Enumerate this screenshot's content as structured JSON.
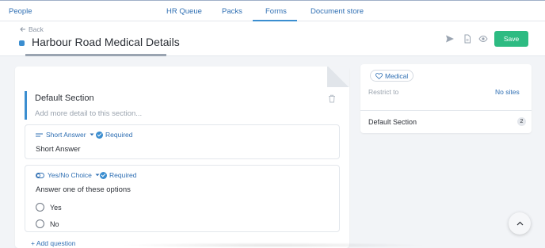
{
  "nav": {
    "people": "People",
    "tabs": [
      {
        "label": "HR Queue"
      },
      {
        "label": "Packs"
      },
      {
        "label": "Forms"
      },
      {
        "label": "Document store"
      }
    ],
    "active_tab": "Forms"
  },
  "header": {
    "back": "Back",
    "title": "Harbour Road Medical Details",
    "save": "Save"
  },
  "form": {
    "section_title": "Default Section",
    "section_placeholder": "Add more detail to this section...",
    "questions": [
      {
        "type": "Short Answer",
        "required": "Required",
        "label": "Short Answer"
      },
      {
        "type": "Yes/No Choice",
        "required": "Required",
        "label": "Answer one of these options",
        "options": [
          "Yes",
          "No"
        ]
      }
    ],
    "add_question": "+ Add question"
  },
  "side": {
    "badge": "Medical",
    "restrict_label": "Restrict to",
    "restrict_value": "No sites",
    "section_name": "Default Section",
    "section_count": "2"
  },
  "colors": {
    "accent": "#3b8ed0",
    "link": "#2f6fb3",
    "save": "#2dbb82"
  },
  "icons": [
    "arrow-left-icon",
    "send-icon",
    "document-icon",
    "eye-icon",
    "trash-icon",
    "short-answer-icon",
    "toggle-icon",
    "heart-icon",
    "chevron-up-icon"
  ]
}
